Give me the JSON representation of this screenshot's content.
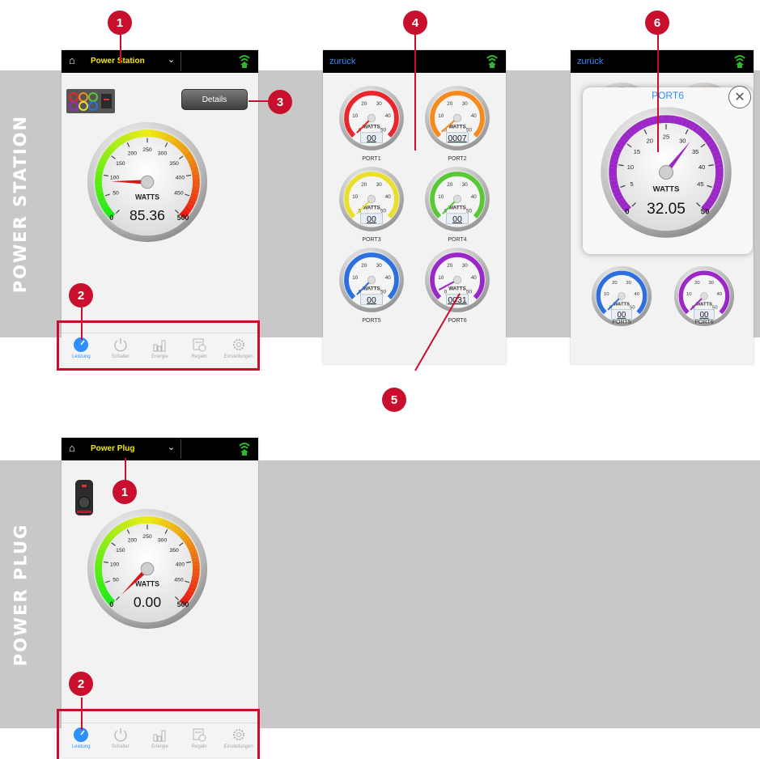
{
  "sections": [
    {
      "label": "POWER STATION"
    },
    {
      "label": "POWER PLUG"
    }
  ],
  "markers": [
    "1",
    "2",
    "3",
    "4",
    "5",
    "6"
  ],
  "colors": {
    "marker": "#c8102e",
    "accent_blue": "#2e8fff",
    "device_name": "#f5e900",
    "wifi": "#2db82d",
    "band": "#c8c8c8"
  },
  "power_station_screen": {
    "device_name": "Power Station",
    "details_button": "Details",
    "gauge": {
      "unit": "WATTS",
      "reading": "85.36",
      "ticks": [
        "0",
        "50",
        "100",
        "150",
        "200",
        "250",
        "300",
        "350",
        "400",
        "450",
        "500"
      ],
      "min": 0,
      "max": 500,
      "value": 85.36
    }
  },
  "ports_screen": {
    "back_label": "zurück",
    "ports": [
      {
        "name": "PORT1",
        "color": "#e8262b",
        "reading": "00",
        "value": 0
      },
      {
        "name": "PORT2",
        "color": "#f58a1f",
        "reading": "0007",
        "value": 0.7
      },
      {
        "name": "PORT3",
        "color": "#eadf2a",
        "reading": "00",
        "value": 0
      },
      {
        "name": "PORT4",
        "color": "#59c834",
        "reading": "00",
        "value": 0
      },
      {
        "name": "PORT5",
        "color": "#2e6fe0",
        "reading": "00",
        "value": 0
      },
      {
        "name": "PORT6",
        "color": "#9b27c7",
        "reading": "0031",
        "value": 3.1
      }
    ],
    "port_gauge": {
      "unit": "WATTS",
      "ticks": [
        "0",
        "10",
        "20",
        "30",
        "40",
        "50"
      ],
      "min": 0,
      "max": 50
    }
  },
  "port_detail_screen": {
    "back_label": "zurück",
    "popup_title": "PORT6",
    "close_symbol": "✕",
    "background_ports": [
      "PORT5",
      "PORT6"
    ],
    "background_readings": [
      "00",
      "00"
    ],
    "gauge": {
      "unit": "WATTS",
      "reading": "32.05",
      "ticks": [
        "0",
        "5",
        "10",
        "15",
        "20",
        "25",
        "30",
        "35",
        "40",
        "45",
        "50"
      ],
      "min": 0,
      "max": 50,
      "value": 32.05
    }
  },
  "power_plug_screen": {
    "device_name": "Power Plug",
    "gauge": {
      "unit": "WATTS",
      "reading": "0.00",
      "ticks": [
        "0",
        "50",
        "100",
        "150",
        "200",
        "250",
        "300",
        "350",
        "400",
        "450",
        "500"
      ],
      "min": 0,
      "max": 500,
      "value": 0
    }
  },
  "tabbar": {
    "tabs": [
      {
        "label": "Leistung",
        "icon": "gauge-icon",
        "active": true
      },
      {
        "label": "Schalter",
        "icon": "power-icon",
        "active": false
      },
      {
        "label": "Energie",
        "icon": "bar-chart-icon",
        "active": false
      },
      {
        "label": "Regeln",
        "icon": "calendar-clock-icon",
        "active": false
      },
      {
        "label": "Einstellungen",
        "icon": "gear-icon",
        "active": false
      }
    ]
  }
}
